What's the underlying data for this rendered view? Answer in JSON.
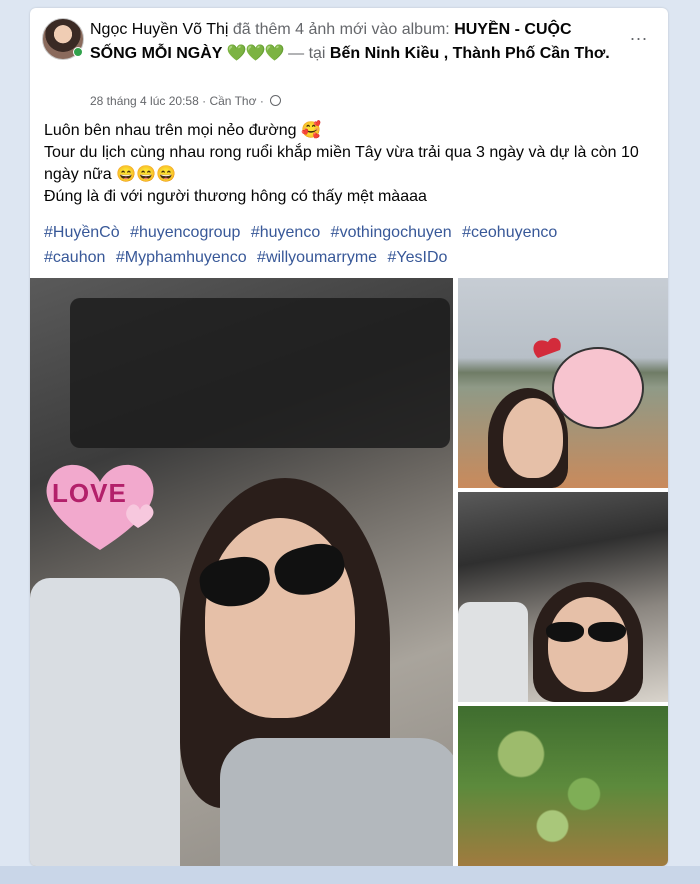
{
  "post": {
    "author": "Ngọc Huyền Võ Thị",
    "action": "đã thêm 4 ảnh mới vào album:",
    "album": "HUYỀN - CUỘC SỐNG MỖI NGÀY",
    "hearts": "💚💚💚",
    "location_prefix": "— tại",
    "location": "Bến Ninh Kiều , Thành Phố Cần Thơ.",
    "more": "...",
    "date": "28 tháng 4 lúc 20:58",
    "place": "Cần Thơ",
    "separator": "·",
    "lines": [
      "Luôn bên nhau trên mọi nẻo đường 🥰",
      "Tour du lịch cùng nhau rong ruổi khắp miền Tây vừa trải qua 3 ngày và dự là còn 10 ngày nữa 😄😄😄",
      "Đúng là đi với người thương hông có thấy mệt màaaa"
    ],
    "hashtags": [
      "#HuyềnCò",
      "#huyencogroup",
      "#huyenco",
      "#vothingochuyen",
      "#ceohuyenco",
      "#cauhon",
      "#Myphamhuyenco",
      "#willyoumarryme",
      "#YesIDo"
    ],
    "sticker_text": "LOVE"
  },
  "colors": {
    "link": "#385898",
    "text": "#050505",
    "muted": "#65676b",
    "hearts": "#4cb050",
    "background": "#dde6f2"
  }
}
